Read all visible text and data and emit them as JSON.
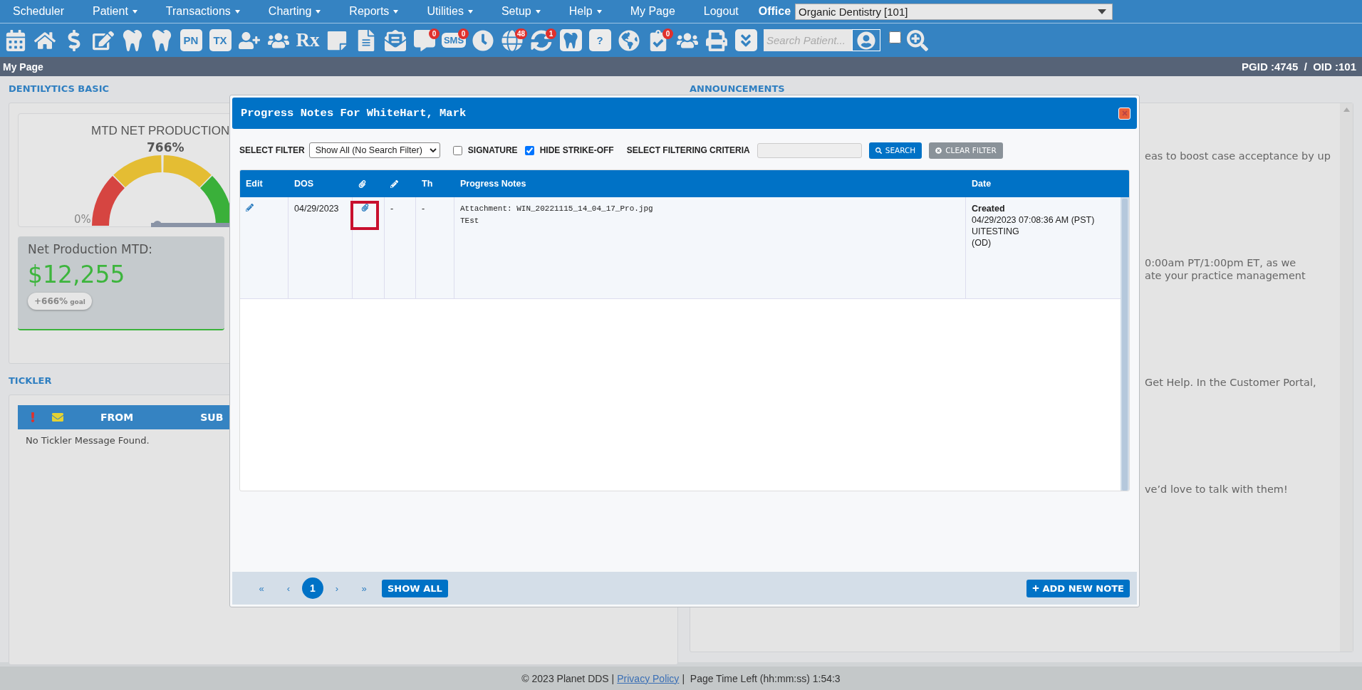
{
  "menu": {
    "items": [
      {
        "label": "Scheduler",
        "has_menu": false
      },
      {
        "label": "Patient",
        "has_menu": true
      },
      {
        "label": "Transactions",
        "has_menu": true
      },
      {
        "label": "Charting",
        "has_menu": true
      },
      {
        "label": "Reports",
        "has_menu": true
      },
      {
        "label": "Utilities",
        "has_menu": true
      },
      {
        "label": "Setup",
        "has_menu": true
      },
      {
        "label": "Help",
        "has_menu": true
      },
      {
        "label": "My Page",
        "has_menu": false
      },
      {
        "label": "Logout",
        "has_menu": false
      }
    ],
    "office_label": "Office",
    "office_select": "Organic Dentistry [101]"
  },
  "toolbar": {
    "icons": [
      {
        "kind": "calendar"
      },
      {
        "kind": "home"
      },
      {
        "kind": "dollar"
      },
      {
        "kind": "notes-edit"
      },
      {
        "kind": "tooth"
      },
      {
        "kind": "tooth-roots"
      },
      {
        "kind": "label",
        "label": "PN"
      },
      {
        "kind": "label",
        "label": "TX"
      },
      {
        "kind": "user-plus"
      },
      {
        "kind": "users-plus"
      },
      {
        "kind": "rx",
        "label": "Rx"
      },
      {
        "kind": "note"
      },
      {
        "kind": "scanner"
      },
      {
        "kind": "mail"
      },
      {
        "kind": "chat",
        "badge": "0"
      },
      {
        "kind": "sms",
        "label": "SMS",
        "badge": "0"
      },
      {
        "kind": "clock"
      },
      {
        "kind": "globe-user",
        "badge": "48"
      },
      {
        "kind": "sync-user",
        "badge": "1"
      },
      {
        "kind": "tooth-tile"
      },
      {
        "kind": "tooth-question",
        "label": "?"
      },
      {
        "kind": "globe"
      },
      {
        "kind": "doc-check",
        "badge": "0"
      },
      {
        "kind": "family"
      },
      {
        "kind": "printer"
      },
      {
        "kind": "chevrons"
      }
    ],
    "search": {
      "placeholder": "Search Patient..."
    },
    "toggle": {
      "checked": false
    }
  },
  "page_bar": {
    "title": "My Page",
    "ids": "PGID :4745  /  OID :101"
  },
  "dentilytics": {
    "heading": "DENTILYTICS BASIC",
    "gauge": {
      "title": "MTD NET PRODUCTION",
      "percent": "766%",
      "min_label": "0%"
    },
    "net_card": {
      "label": "Net Production MTD:",
      "amount": "$12,255",
      "change": "+666%",
      "change_unit": "goal"
    }
  },
  "tickler": {
    "heading": "TICKLER",
    "columns": [
      "FROM",
      "SUB"
    ],
    "empty": "No Tickler Message Found."
  },
  "announcements": {
    "heading": "ANNOUNCEMENTS",
    "paragraphs": [
      [
        "eas to boost case acceptance by up"
      ],
      [
        "0:00am PT/1:00pm ET, as we",
        "ate your practice management"
      ],
      [
        "Get Help. In the Customer Portal,"
      ],
      [
        "ve’d love to talk with them!"
      ]
    ]
  },
  "dialog": {
    "title": "Progress Notes For WhiteHart, Mark",
    "filter": {
      "label": "SELECT FILTER",
      "value": "Show All (No Search Filter)",
      "signature": {
        "label": "SIGNATURE",
        "checked": false
      },
      "hide_strike_off": {
        "label": "HIDE STRIKE-OFF",
        "checked": true
      },
      "criteria_label": "SELECT FILTERING CRITERIA",
      "search": "SEARCH",
      "clear": "CLEAR FILTER"
    },
    "columns": [
      {
        "kind": "text",
        "label": "Edit"
      },
      {
        "kind": "text",
        "label": "DOS"
      },
      {
        "kind": "attach"
      },
      {
        "kind": "edit"
      },
      {
        "kind": "text",
        "label": "Th"
      },
      {
        "kind": "text",
        "label": "Progress Notes"
      },
      {
        "kind": "text",
        "label": "Date"
      }
    ],
    "rows": [
      {
        "dos": "04/29/2023",
        "attachment": true,
        "highlighted": true,
        "column_4": "-",
        "th": "-",
        "notes": [
          "Attachment: WIN_20221115_14_04_17_Pro.jpg",
          "TEst"
        ],
        "date": {
          "status": "Created",
          "timestamp": "04/29/2023 07:08:36 AM (PST)",
          "user": "UITESTING",
          "office": "(OD)"
        }
      }
    ],
    "pager": {
      "first": "«",
      "prev": "‹",
      "pages": [
        {
          "label": "1",
          "selected": true
        }
      ],
      "next": "›",
      "last": "»",
      "show_all": "SHOW ALL"
    },
    "add_note": "ADD NEW NOTE"
  },
  "footer": {
    "copyright": "© 2023 Planet DDS |",
    "link": "Privacy Policy",
    "time_left": "|  Page Time Left (hh:mm:ss) 1:54:3"
  }
}
